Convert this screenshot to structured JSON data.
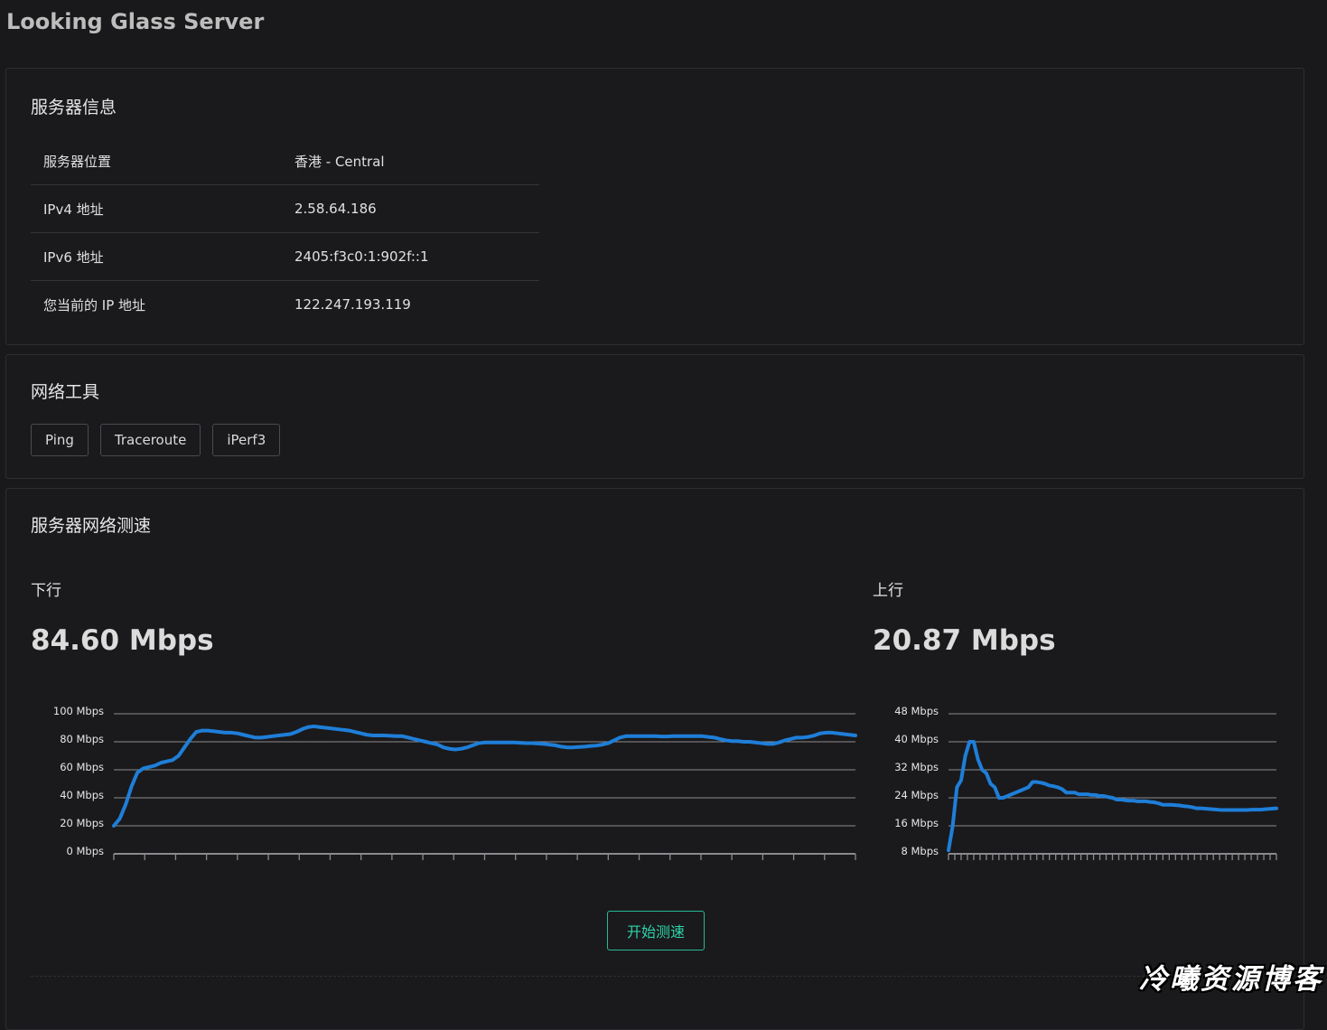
{
  "app": {
    "title": "Looking Glass Server"
  },
  "server_info": {
    "title": "服务器信息",
    "rows": [
      {
        "key": "服务器位置",
        "value": "香港 - Central"
      },
      {
        "key": "IPv4 地址",
        "value": "2.58.64.186"
      },
      {
        "key": "IPv6 地址",
        "value": "2405:f3c0:1:902f::1"
      },
      {
        "key": "您当前的 IP 地址",
        "value": "122.247.193.119"
      }
    ]
  },
  "tools": {
    "title": "网络工具",
    "buttons": [
      {
        "label": "Ping"
      },
      {
        "label": "Traceroute"
      },
      {
        "label": "iPerf3"
      }
    ]
  },
  "speedtest": {
    "title": "服务器网络测速",
    "start_label": "开始测速",
    "colors": {
      "line": "#1e7ed8",
      "accent": "#27b895"
    },
    "download": {
      "label": "下行",
      "value": "84.60 Mbps"
    },
    "upload": {
      "label": "上行",
      "value": "20.87 Mbps"
    }
  },
  "chart_data": [
    {
      "type": "line",
      "title": "下行",
      "y_tick_labels": [
        "100 Mbps",
        "80 Mbps",
        "60 Mbps",
        "40 Mbps",
        "20 Mbps",
        "0 Mbps"
      ],
      "ylim": [
        0,
        100
      ],
      "y_unit": "Mbps",
      "grid": true,
      "series": [
        {
          "values": [
            20,
            25,
            35,
            48,
            58,
            61,
            62,
            63,
            65,
            66,
            67,
            70,
            76,
            82,
            87,
            88,
            88,
            87.5,
            87,
            86.5,
            86.5,
            86,
            85,
            84,
            83,
            83,
            83.5,
            84,
            84.5,
            85,
            85.5,
            87,
            89,
            90.5,
            91,
            90.5,
            90,
            89.5,
            89,
            88.5,
            88,
            87,
            86,
            85,
            84.5,
            84.5,
            84.5,
            84.3,
            84,
            84,
            83,
            82,
            81,
            80,
            79,
            78,
            76,
            75,
            74.5,
            75,
            76,
            77.5,
            79,
            79.5,
            79.5,
            79.5,
            79.5,
            79.5,
            79.5,
            79.3,
            79,
            79,
            78.8,
            78.5,
            78,
            77.5,
            76.5,
            76,
            76,
            76.3,
            76.5,
            77,
            77.3,
            78,
            79,
            81,
            83,
            84,
            84,
            84,
            84,
            84,
            84,
            83.8,
            83.8,
            84,
            84,
            84,
            84,
            84,
            84,
            83.5,
            83,
            82,
            81,
            80.5,
            80.5,
            80,
            80,
            79.5,
            79,
            78.5,
            78.5,
            79.5,
            81,
            82,
            83,
            83,
            83.5,
            84.5,
            86,
            86.5,
            86.5,
            86,
            85.5,
            85,
            84.5
          ]
        }
      ]
    },
    {
      "type": "line",
      "title": "上行",
      "y_tick_labels": [
        "48 Mbps",
        "40 Mbps",
        "32 Mbps",
        "24 Mbps",
        "16 Mbps",
        "8 Mbps"
      ],
      "ylim": [
        8,
        48
      ],
      "y_unit": "Mbps",
      "grid": true,
      "series": [
        {
          "values": [
            9,
            16,
            27,
            29,
            36,
            40,
            40,
            35,
            32,
            31,
            28,
            27,
            24,
            24,
            24.5,
            25,
            25.5,
            26,
            26.5,
            27,
            28.5,
            28.5,
            28.3,
            28,
            27.5,
            27.3,
            27,
            26.5,
            25.5,
            25.5,
            25.5,
            25,
            25,
            25,
            24.8,
            24.8,
            24.5,
            24.5,
            24.2,
            24,
            23.5,
            23.5,
            23.3,
            23.2,
            23.2,
            23,
            23,
            23,
            22.8,
            22.7,
            22.4,
            22,
            22,
            22,
            21.9,
            21.8,
            21.6,
            21.5,
            21.3,
            21,
            21,
            20.9,
            20.8,
            20.7,
            20.6,
            20.5,
            20.5,
            20.5,
            20.5,
            20.5,
            20.5,
            20.5,
            20.6,
            20.6,
            20.6,
            20.7,
            20.8,
            20.9,
            21
          ]
        }
      ]
    }
  ],
  "watermark": {
    "text": "冷曦资源博客"
  }
}
